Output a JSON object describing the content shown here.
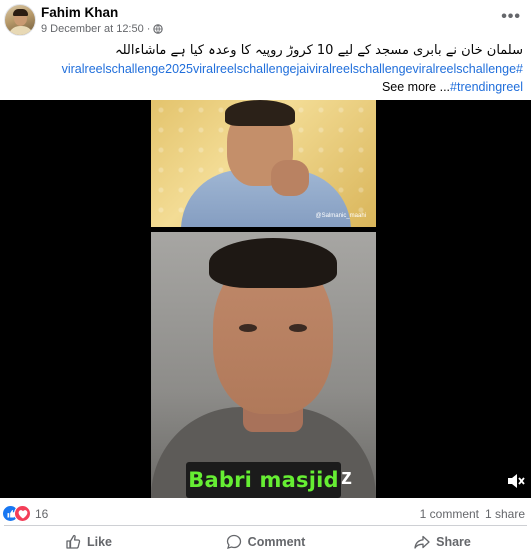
{
  "post": {
    "author": "Fahim Khan",
    "date": "9 December at 12:50",
    "separator": "·",
    "more_label": "•••"
  },
  "caption": {
    "urdu_text": "سلمان خان نے بابری مسجد کے لیے 10 کروڑ روپیہ کا وعدہ کیا ہے ماشاءاللہ",
    "hashtags_line": "viralreelschallenge2025viralreelschallengejaiviralreelschallengeviralreelschallenge#",
    "see_more": "See more ...",
    "hashtag_trending": "#trendingreel"
  },
  "video": {
    "subtitle": "Babri masjid",
    "subtitle_left_fragment": "",
    "subtitle_right_fragment": "z",
    "watermark": "@Salmanic_maahi"
  },
  "reactions": {
    "count": "16",
    "comments": "1 comment",
    "shares": "1 share"
  },
  "actions": {
    "like": "Like",
    "comment": "Comment",
    "share": "Share"
  },
  "colors": {
    "link": "#216fdb",
    "muted": "#65676b",
    "like_blue": "#1877f2",
    "love_red": "#f33e58",
    "subtitle_green": "#66ee33"
  }
}
